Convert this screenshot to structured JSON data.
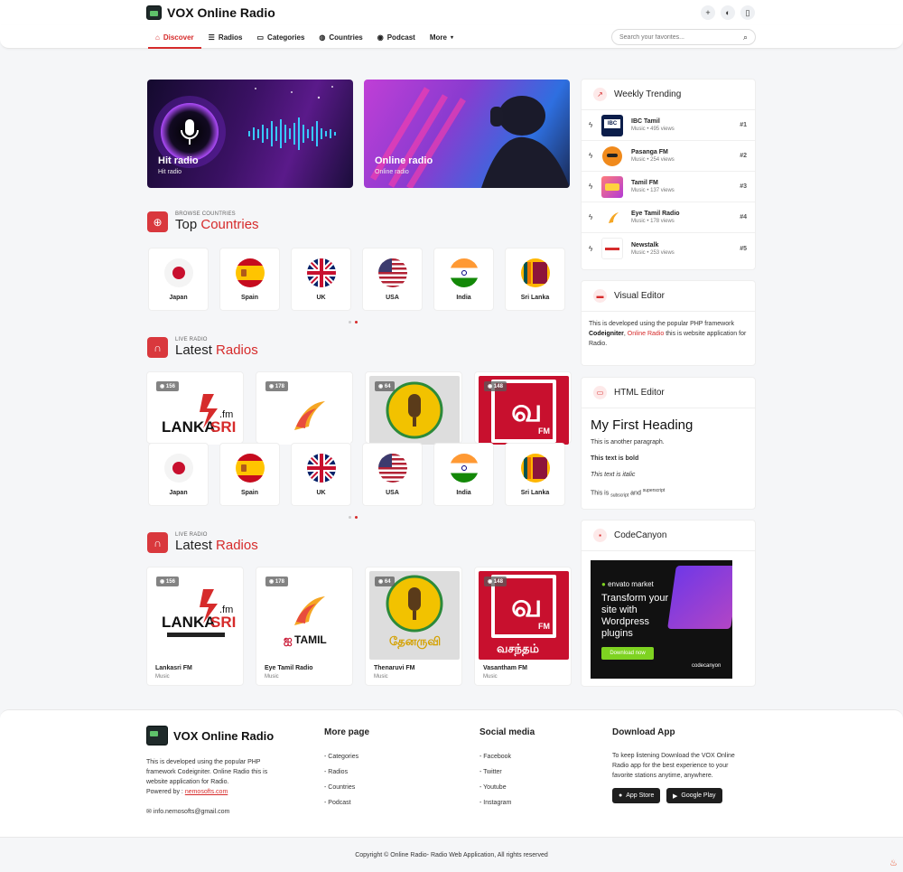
{
  "app": {
    "title": "VOX Online Radio"
  },
  "top_icons": [
    "plus-icon",
    "moon-icon",
    "bookmark-icon"
  ],
  "nav": [
    {
      "label": "Discover",
      "icon": "home-icon",
      "active": true
    },
    {
      "label": "Radios",
      "icon": "list-icon"
    },
    {
      "label": "Categories",
      "icon": "folder-icon"
    },
    {
      "label": "Countries",
      "icon": "globe-icon"
    },
    {
      "label": "Podcast",
      "icon": "podcast-icon"
    },
    {
      "label": "More",
      "icon": "chevron-down-icon"
    }
  ],
  "search": {
    "placeholder": "Search your favorites..."
  },
  "banners": [
    {
      "title": "Hit radio",
      "subtitle": "Hit radio"
    },
    {
      "title": "Online radio",
      "subtitle": "Online radio"
    }
  ],
  "countries_section": {
    "small": "BROWSE COUNTRIES",
    "title": "Top ",
    "highlight": "Countries"
  },
  "countries": [
    "Japan",
    "Spain",
    "UK",
    "USA",
    "India",
    "Sri Lanka"
  ],
  "radios_section_1": {
    "small": "LIVE RADIO",
    "title": "Latest ",
    "highlight": "Radios"
  },
  "radios_section_2": {
    "small": "LIVE RADIO",
    "title": "Latest ",
    "highlight": "Radios"
  },
  "radios": [
    {
      "name": "Lankasri FM",
      "genre": "Music",
      "views": "156"
    },
    {
      "name": "Eye Tamil Radio",
      "genre": "Music",
      "views": "178"
    },
    {
      "name": "Thenaruvi FM",
      "genre": "Music",
      "views": "64"
    },
    {
      "name": "Vasantham FM",
      "genre": "Music",
      "views": "148"
    }
  ],
  "trending": {
    "title": "Weekly Trending",
    "items": [
      {
        "name": "IBC Tamil",
        "meta": "Music • 495 views",
        "rank": "#1"
      },
      {
        "name": "Pasanga FM",
        "meta": "Music • 254 views",
        "rank": "#2"
      },
      {
        "name": "Tamil FM",
        "meta": "Music • 137 views",
        "rank": "#3"
      },
      {
        "name": "Eye Tamil Radio",
        "meta": "Music • 178 views",
        "rank": "#4"
      },
      {
        "name": "Newstalk",
        "meta": "Music • 253 views",
        "rank": "#5"
      }
    ]
  },
  "visual_editor": {
    "title": "Visual Editor",
    "text1": "This is developed using the popular PHP framework",
    "bold": "Codeigniter",
    "link": "Online Radio",
    "text2": "this is website application for Radio."
  },
  "html_editor": {
    "title": "HTML Editor",
    "heading": "My First Heading",
    "para": "This is another paragraph.",
    "bold": "This text is bold",
    "italic": "This text is italic",
    "this_is": "This is",
    "sub": "subscript",
    "and": "and",
    "sup": "superscript"
  },
  "codecanyon": {
    "title": "CodeCanyon",
    "brand": "envato market",
    "headline": "Transform your site with Wordpress plugins",
    "button": "Download now",
    "footer_brand": "codecanyon"
  },
  "footer": {
    "brand": "VOX Online Radio",
    "desc": "This is developed using the popular PHP framework Codeigniter. Online Radio this is website application for Radio.",
    "powered": "Powered by :",
    "powered_link": "nemosofts.com",
    "email": "info.nemosofts@gmail.com",
    "more_title": "More page",
    "more_links": [
      "- Categories",
      "- Radios",
      "- Countries",
      "- Podcast"
    ],
    "social_title": "Social media",
    "social_links": [
      "- Facebook",
      "- Twitter",
      "- Youtube",
      "- Instagram"
    ],
    "app_title": "Download App",
    "app_desc": "To keep listening Download the VOX Online Radio app for the best experience to your favorite stations anytime, anywhere.",
    "app_store": "App Store",
    "google_play": "Google Play",
    "copyright": "Copyright © Online Radio- Radio Web Application, All rights reserved"
  },
  "colors": {
    "accent": "#d62b2b"
  }
}
